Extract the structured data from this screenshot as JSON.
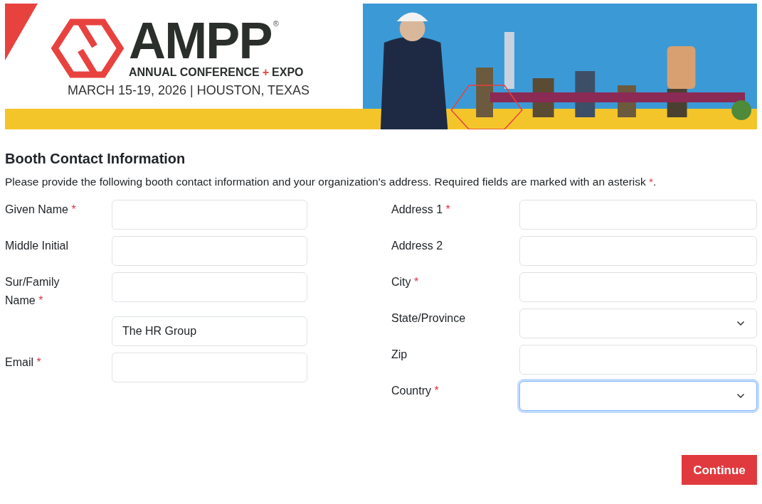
{
  "banner": {
    "logo_word": "AMPP",
    "registered": "®",
    "event_name": "ANNUAL CONFERENCE",
    "plus": "+",
    "event_kind": "EXPO",
    "dates": "MARCH 15-19, 2026 | HOUSTON, TEXAS",
    "kind": "picture"
  },
  "form": {
    "title": "Booth Contact Information",
    "intro": "Please provide the following booth contact information and your organization's address. Required fields are marked with an asterisk ",
    "intro_end": ".",
    "required_mark": "*",
    "left_fields": [
      {
        "label": "Given Name",
        "required": true,
        "kind": "text",
        "focused": false
      },
      {
        "label": "Middle Initial",
        "required": false,
        "kind": "text",
        "focused": false
      },
      {
        "label": "Sur/Family Name",
        "required": true,
        "kind": "text",
        "focused": false
      },
      {
        "kind": "text",
        "value": "The HR Group",
        "focused": false
      },
      {
        "label": "Email",
        "required": true,
        "kind": "text",
        "focused": false
      }
    ],
    "right_fields": [
      {
        "label": "Address 1",
        "required": true,
        "kind": "text",
        "focused": false
      },
      {
        "label": "Address 2",
        "required": false,
        "kind": "text",
        "focused": false
      },
      {
        "label": "City",
        "required": true,
        "kind": "text",
        "focused": false
      },
      {
        "label": "State/Province",
        "required": false,
        "kind": "select",
        "focused": false
      },
      {
        "label": "Zip",
        "required": false,
        "kind": "text",
        "focused": false
      },
      {
        "label": "Country",
        "required": true,
        "kind": "select",
        "focused": true
      }
    ]
  },
  "continue_button": "Continue"
}
